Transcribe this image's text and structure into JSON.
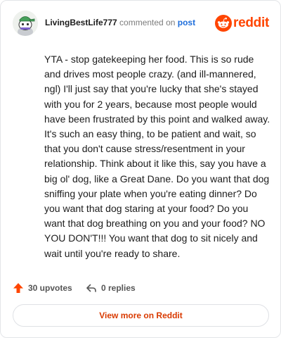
{
  "header": {
    "username": "LivingBestLife777",
    "action_text": " commented on ",
    "post_link": "post",
    "brand": "reddit",
    "avatar_icon": "snoo-avatar-icon",
    "brand_icon": "reddit-logo-icon"
  },
  "comment": {
    "text": "YTA - stop gatekeeping her food. This is so rude and drives most people crazy. (and ill-mannered, ngl) I'll just say that you're lucky that she's stayed with you for 2 years, because most people would have been frustrated by this point and walked away. It's such an easy thing, to be patient and wait, so that you don't cause stress/resentment in your relationship. Think about it like this, say you have a big ol' dog, like a Great Dane. Do you want that dog sniffing your plate when you're eating dinner? Do you want that dog staring at your food? Do you want that dog breathing on you and your food? NO YOU DON'T!!! You want that dog to sit nicely and wait until you're ready to share."
  },
  "actions": {
    "upvotes": "30 upvotes",
    "replies": "0 replies",
    "upvote_icon": "upvote-arrow-icon",
    "reply_icon": "reply-arrow-icon"
  },
  "footer": {
    "view_more": "View more on Reddit"
  },
  "colors": {
    "brand": "#ff4500",
    "link": "#1d6ddb",
    "view_more": "#d93a00"
  }
}
